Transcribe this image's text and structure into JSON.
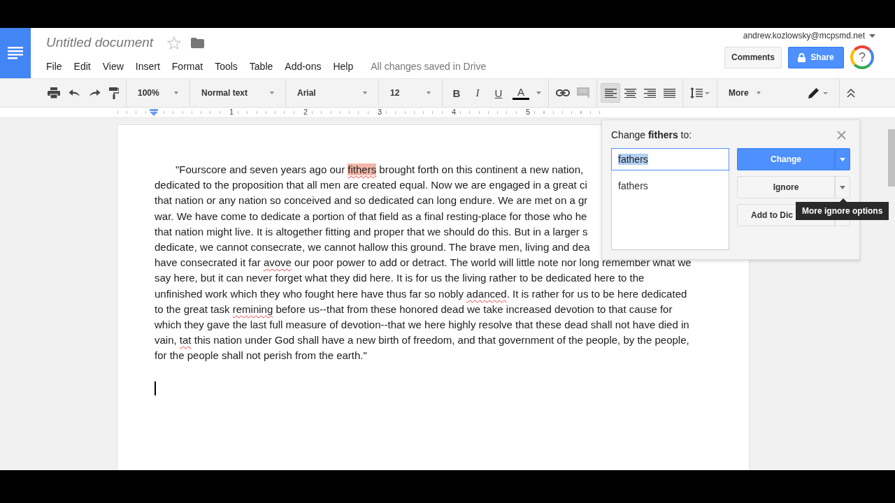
{
  "app": {
    "title": "Untitled document",
    "starred": false,
    "menu": [
      "File",
      "Edit",
      "View",
      "Insert",
      "Format",
      "Tools",
      "Table",
      "Add-ons",
      "Help"
    ],
    "save_status": "All changes saved in Drive",
    "account": "andrew.kozlowsky@mcpsmd.net",
    "comments_button": "Comments",
    "share_button": "Share",
    "help_button": "?"
  },
  "toolbar": {
    "zoom": "100%",
    "style": "Normal text",
    "font": "Arial",
    "size": "12",
    "bold": "B",
    "italic": "I",
    "underline": "U",
    "text_color": "A",
    "more": "More",
    "alignments": [
      {
        "kind": "left",
        "selected": true
      },
      {
        "kind": "center",
        "selected": false
      },
      {
        "kind": "right",
        "selected": false
      },
      {
        "kind": "justify",
        "selected": false
      }
    ]
  },
  "ruler": [
    "1",
    "2",
    "3",
    "4",
    "5"
  ],
  "document": {
    "lines": [
      [
        {
          "text": "\"Fourscore and seven years ago our ",
          "kind": "plain"
        },
        {
          "text": "fithers",
          "kind": "flagged"
        },
        {
          "text": " brought forth on this continent a new nation,",
          "kind": "plain"
        }
      ],
      [
        {
          "text": "dedicated to the proposition that all men are created equal. Now we are engaged in a great ci",
          "kind": "plain"
        }
      ],
      [
        {
          "text": "that nation or any nation so conceived and so dedicated can long endure. We are met on a gr",
          "kind": "plain"
        }
      ],
      [
        {
          "text": "war. We have come to dedicate a portion of that field as a final resting-place for those who he",
          "kind": "plain"
        }
      ],
      [
        {
          "text": "that nation might live. It is altogether fitting and proper that we should do this. But in a larger s",
          "kind": "plain"
        }
      ],
      [
        {
          "text": "dedicate, we cannot consecrate, we cannot hallow this ground. The brave men, living and dea",
          "kind": "plain"
        }
      ],
      [
        {
          "text": "have consecrated it far ",
          "kind": "plain"
        },
        {
          "text": "avove",
          "kind": "misspelled"
        },
        {
          "text": " our poor power to add or detract. The world will little note nor long remember what we",
          "kind": "plain"
        }
      ],
      [
        {
          "text": "say here, but it can never forget what they did here. It is for us the living rather to be dedicated here to the",
          "kind": "plain"
        }
      ],
      [
        {
          "text": "unfinished work which they who fought here have thus far so nobly ",
          "kind": "plain"
        },
        {
          "text": "adanced",
          "kind": "misspelled"
        },
        {
          "text": ". It is rather for us to be here dedicated",
          "kind": "plain"
        }
      ],
      [
        {
          "text": "to the great task ",
          "kind": "plain"
        },
        {
          "text": "remining",
          "kind": "misspelled"
        },
        {
          "text": " before us--that from these honored dead we take increased devotion to that cause for",
          "kind": "plain"
        }
      ],
      [
        {
          "text": "which they gave the last full measure of devotion--that we here highly resolve that these dead shall not have died in",
          "kind": "plain"
        }
      ],
      [
        {
          "text": "vain, ",
          "kind": "plain"
        },
        {
          "text": "tat",
          "kind": "misspelled"
        },
        {
          "text": " this nation under God shall have a new birth of freedom, and that government of the people, by the people,",
          "kind": "plain"
        }
      ],
      [
        {
          "text": "for the people shall not perish from the earth.\"",
          "kind": "plain"
        }
      ]
    ]
  },
  "spell_dialog": {
    "title": "Change **fithers** to:",
    "value": "fathers",
    "suggestions": [
      "fathers"
    ],
    "change_button": "Change",
    "ignore_button": "Ignore",
    "add_button": "Add to Dic",
    "tooltip": "More ignore options"
  }
}
